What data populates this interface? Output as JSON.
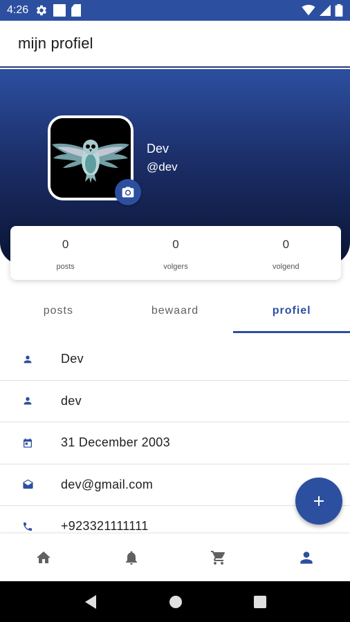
{
  "status_bar": {
    "time": "4:26"
  },
  "app_bar": {
    "title": "mijn profiel"
  },
  "profile": {
    "name": "Dev",
    "handle": "@dev"
  },
  "stats": [
    {
      "value": "0",
      "label": "posts"
    },
    {
      "value": "0",
      "label": "volgers"
    },
    {
      "value": "0",
      "label": "volgend"
    }
  ],
  "tabs": [
    {
      "label": "posts",
      "active": false
    },
    {
      "label": "bewaard",
      "active": false
    },
    {
      "label": "profiel",
      "active": true
    }
  ],
  "info": [
    {
      "icon": "person-icon",
      "text": "Dev"
    },
    {
      "icon": "person-icon",
      "text": "dev"
    },
    {
      "icon": "calendar-icon",
      "text": "31 December 2003"
    },
    {
      "icon": "email-icon",
      "text": "dev@gmail.com"
    },
    {
      "icon": "phone-icon",
      "text": "+923321111111"
    }
  ],
  "bottom_nav": [
    {
      "icon": "home-icon",
      "active": false
    },
    {
      "icon": "bell-icon",
      "active": false
    },
    {
      "icon": "cart-icon",
      "active": false
    },
    {
      "icon": "person-icon",
      "active": true
    }
  ],
  "colors": {
    "primary": "#2d4fa0",
    "header_dark": "#0a1433",
    "inactive_icon": "#616161"
  }
}
